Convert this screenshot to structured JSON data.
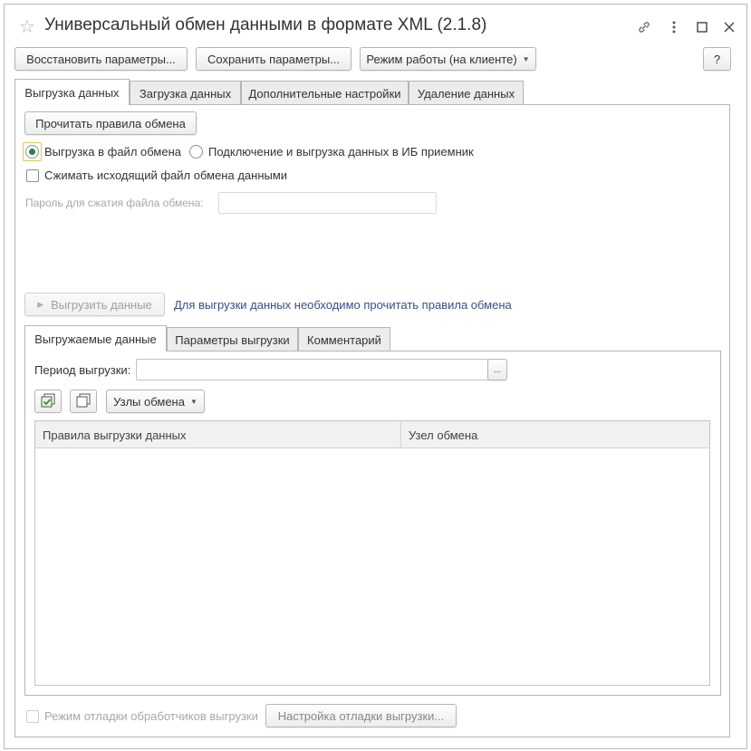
{
  "window": {
    "title": "Универсальный обмен данными в формате XML (2.1.8)"
  },
  "toolbar": {
    "restore_label": "Восстановить параметры...",
    "save_label": "Сохранить параметры...",
    "mode_label": "Режим работы (на клиенте)",
    "help_label": "?"
  },
  "tabs": [
    {
      "label": "Выгрузка данных",
      "active": true
    },
    {
      "label": "Загрузка данных",
      "active": false
    },
    {
      "label": "Дополнительные настройки",
      "active": false
    },
    {
      "label": "Удаление данных",
      "active": false
    }
  ],
  "export": {
    "read_rules_label": "Прочитать правила обмена",
    "radio_file_label": "Выгрузка в файл обмена",
    "radio_connect_label": "Подключение и выгрузка данных в ИБ приемник",
    "compress_label": "Сжимать исходящий файл обмена данными",
    "password_label": "Пароль для сжатия файла обмена:",
    "password_value": "",
    "export_button_label": "Выгрузить данные",
    "hint_link": "Для выгрузки данных необходимо прочитать правила обмена"
  },
  "subtabs": [
    {
      "label": "Выгружаемые данные",
      "active": true
    },
    {
      "label": "Параметры выгрузки",
      "active": false
    },
    {
      "label": "Комментарий",
      "active": false
    }
  ],
  "exported_data": {
    "period_label": "Период выгрузки:",
    "period_value": "",
    "period_button": "...",
    "nodes_label": "Узлы обмена",
    "columns": [
      "Правила выгрузки данных",
      "Узел обмена"
    ],
    "rows": []
  },
  "footer": {
    "debug_mode_label": "Режим отладки обработчиков выгрузки",
    "debug_settings_label": "Настройка отладки выгрузки..."
  },
  "colors": {
    "accent_radio": "#2e7d4f",
    "link": "#3b4c8c",
    "focus": "#e2c64d"
  }
}
